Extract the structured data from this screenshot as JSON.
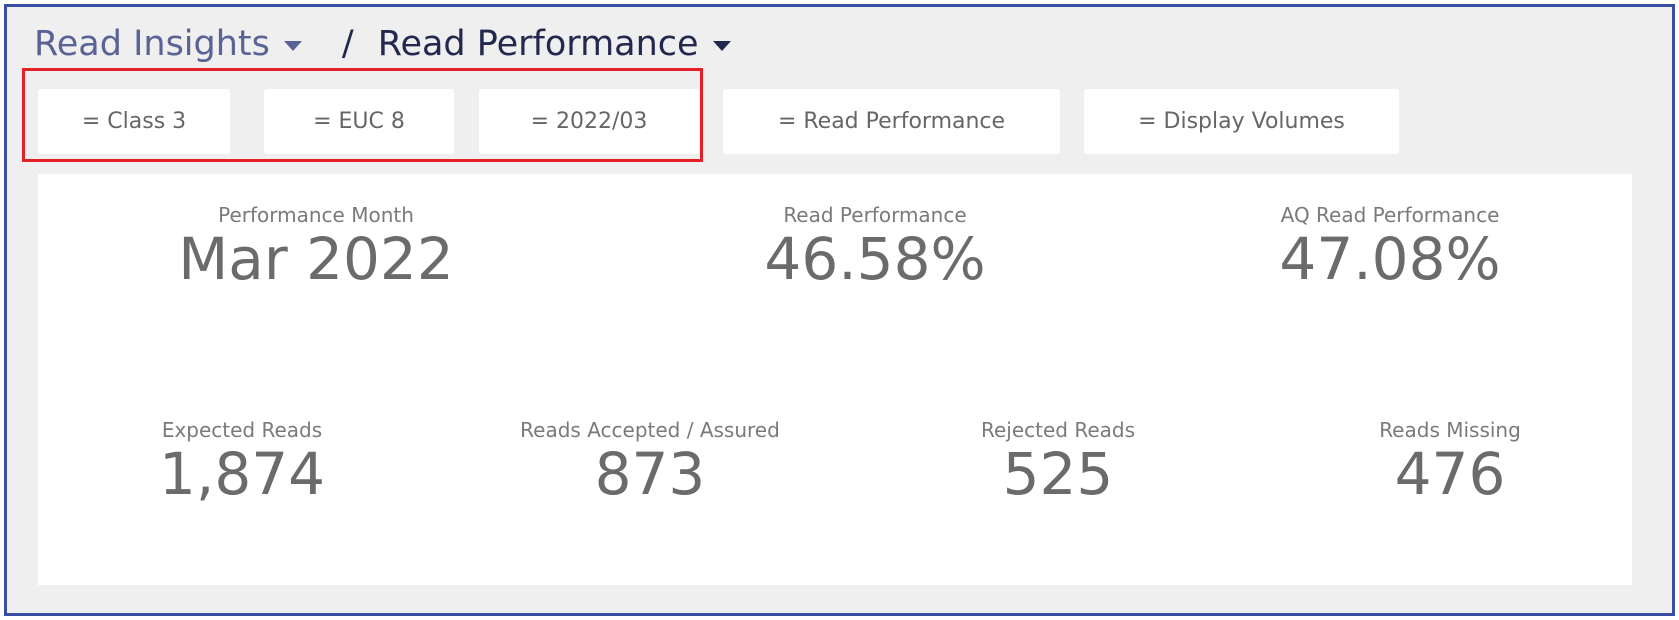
{
  "breadcrumb": {
    "parent": "Read Insights",
    "separator": "/",
    "current": "Read Performance"
  },
  "filters": [
    {
      "label": "= Class 3"
    },
    {
      "label": "= EUC 8"
    },
    {
      "label": "= 2022/03"
    },
    {
      "label": "= Read Performance"
    },
    {
      "label": "= Display Volumes"
    }
  ],
  "kpis_top": [
    {
      "label": "Performance Month",
      "value": "Mar 2022"
    },
    {
      "label": "Read Performance",
      "value": "46.58%"
    },
    {
      "label": "AQ Read Performance",
      "value": "47.08%"
    }
  ],
  "kpis_bottom": [
    {
      "label": "Expected Reads",
      "value": "1,874"
    },
    {
      "label": "Reads Accepted / Assured",
      "value": "873"
    },
    {
      "label": "Rejected Reads",
      "value": "525"
    },
    {
      "label": "Reads Missing",
      "value": "476"
    }
  ],
  "colors": {
    "frame_border": "#3a4fa3",
    "highlight": "#e32127",
    "breadcrumb_parent": "#5a6396",
    "breadcrumb_current": "#23284f"
  }
}
